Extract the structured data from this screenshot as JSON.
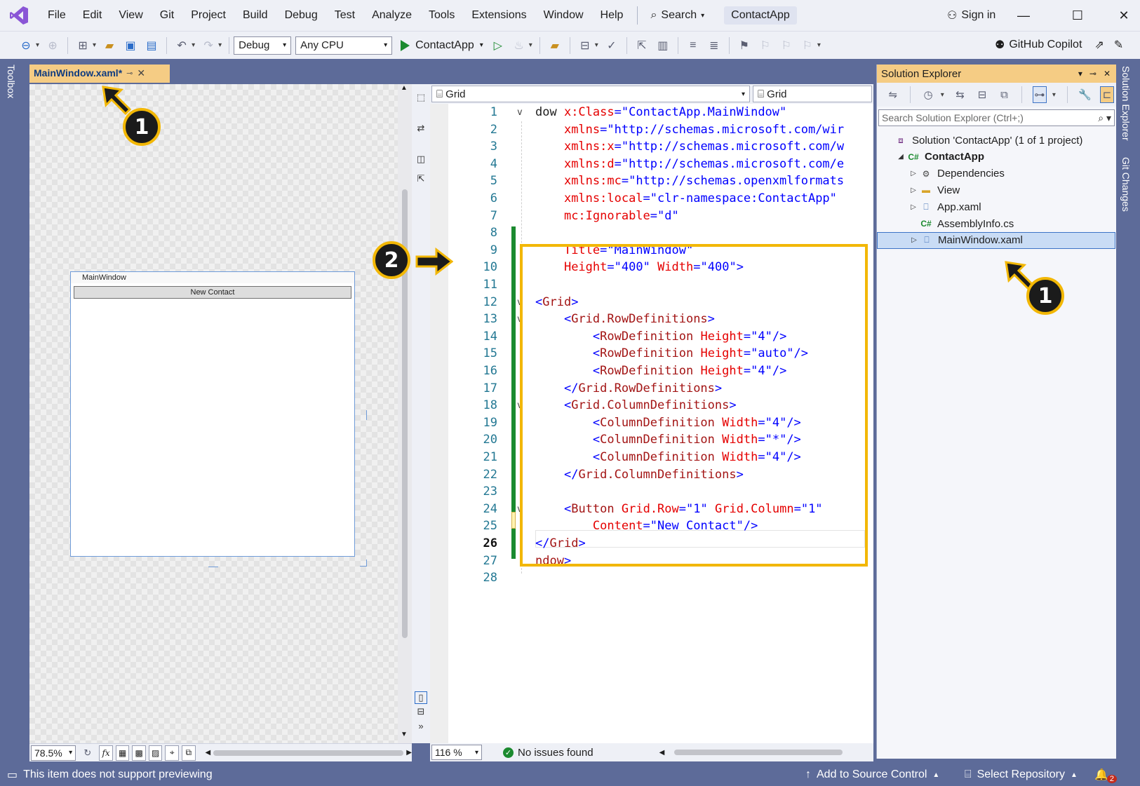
{
  "menu": {
    "items": [
      "File",
      "Edit",
      "View",
      "Git",
      "Project",
      "Build",
      "Debug",
      "Test",
      "Analyze",
      "Tools",
      "Extensions",
      "Window",
      "Help"
    ],
    "search_label": "Search",
    "app_title": "ContactApp",
    "sign_in": "Sign in"
  },
  "toolbar": {
    "config": "Debug",
    "platform": "Any CPU",
    "run_target": "ContactApp",
    "copilot": "GitHub Copilot"
  },
  "side_labels": {
    "toolbox": "Toolbox",
    "solution_explorer": "Solution Explorer",
    "git_changes": "Git Changes"
  },
  "document_tab": {
    "label": "MainWindow.xaml*"
  },
  "designer": {
    "window_title": "MainWindow",
    "button_content": "New Contact",
    "zoom": "78.5%",
    "fx_label": "fx"
  },
  "editor": {
    "nav_left": "Grid",
    "nav_right": "Grid",
    "zoom": "116 %",
    "status": "No issues found",
    "current_line": 26,
    "lines": [
      {
        "n": "1",
        "fold": "v",
        "parts": [
          [
            "tx",
            "dow "
          ],
          [
            "at",
            "x:Class"
          ],
          [
            "br",
            "="
          ],
          [
            "v",
            "\"ContactApp.MainWindow\""
          ]
        ]
      },
      {
        "n": "2",
        "parts": [
          [
            "tx",
            "    "
          ],
          [
            "at",
            "xmlns"
          ],
          [
            "br",
            "="
          ],
          [
            "v",
            "\"http://schemas.microsoft.com/wir"
          ]
        ]
      },
      {
        "n": "3",
        "parts": [
          [
            "tx",
            "    "
          ],
          [
            "at",
            "xmlns:x"
          ],
          [
            "br",
            "="
          ],
          [
            "v",
            "\"http://schemas.microsoft.com/w"
          ]
        ]
      },
      {
        "n": "4",
        "parts": [
          [
            "tx",
            "    "
          ],
          [
            "at",
            "xmlns:d"
          ],
          [
            "br",
            "="
          ],
          [
            "v",
            "\"http://schemas.microsoft.com/e"
          ]
        ]
      },
      {
        "n": "5",
        "parts": [
          [
            "tx",
            "    "
          ],
          [
            "at",
            "xmlns:mc"
          ],
          [
            "br",
            "="
          ],
          [
            "v",
            "\"http://schemas.openxmlformats"
          ]
        ]
      },
      {
        "n": "6",
        "parts": [
          [
            "tx",
            "    "
          ],
          [
            "at",
            "xmlns:local"
          ],
          [
            "br",
            "="
          ],
          [
            "v",
            "\"clr-namespace:ContactApp\""
          ]
        ]
      },
      {
        "n": "7",
        "parts": [
          [
            "tx",
            "    "
          ],
          [
            "at",
            "mc:Ignorable"
          ],
          [
            "br",
            "="
          ],
          [
            "v",
            "\"d\""
          ]
        ]
      },
      {
        "n": "8",
        "parts": []
      },
      {
        "n": "9",
        "parts": [
          [
            "tx",
            "    "
          ],
          [
            "at",
            "Title"
          ],
          [
            "br",
            "="
          ],
          [
            "v",
            "\"MainWindow\""
          ]
        ]
      },
      {
        "n": "10",
        "parts": [
          [
            "tx",
            "    "
          ],
          [
            "at",
            "Height"
          ],
          [
            "br",
            "="
          ],
          [
            "v",
            "\"400\""
          ],
          [
            "tx",
            " "
          ],
          [
            "at",
            "Width"
          ],
          [
            "br",
            "="
          ],
          [
            "v",
            "\"400\""
          ],
          [
            "br",
            ">"
          ]
        ]
      },
      {
        "n": "11",
        "parts": []
      },
      {
        "n": "12",
        "fold": "v",
        "parts": [
          [
            "br",
            "<"
          ],
          [
            "el",
            "Grid"
          ],
          [
            "br",
            ">"
          ]
        ]
      },
      {
        "n": "13",
        "fold": "v",
        "parts": [
          [
            "tx",
            "    "
          ],
          [
            "br",
            "<"
          ],
          [
            "el",
            "Grid.RowDefinitions"
          ],
          [
            "br",
            ">"
          ]
        ]
      },
      {
        "n": "14",
        "parts": [
          [
            "tx",
            "        "
          ],
          [
            "br",
            "<"
          ],
          [
            "el",
            "RowDefinition"
          ],
          [
            "tx",
            " "
          ],
          [
            "at",
            "Height"
          ],
          [
            "br",
            "="
          ],
          [
            "v",
            "\"4\""
          ],
          [
            "br",
            "/>"
          ]
        ]
      },
      {
        "n": "15",
        "parts": [
          [
            "tx",
            "        "
          ],
          [
            "br",
            "<"
          ],
          [
            "el",
            "RowDefinition"
          ],
          [
            "tx",
            " "
          ],
          [
            "at",
            "Height"
          ],
          [
            "br",
            "="
          ],
          [
            "v",
            "\"auto\""
          ],
          [
            "br",
            "/>"
          ]
        ]
      },
      {
        "n": "16",
        "parts": [
          [
            "tx",
            "        "
          ],
          [
            "br",
            "<"
          ],
          [
            "el",
            "RowDefinition"
          ],
          [
            "tx",
            " "
          ],
          [
            "at",
            "Height"
          ],
          [
            "br",
            "="
          ],
          [
            "v",
            "\"4\""
          ],
          [
            "br",
            "/>"
          ]
        ]
      },
      {
        "n": "17",
        "parts": [
          [
            "tx",
            "    "
          ],
          [
            "br",
            "</"
          ],
          [
            "el",
            "Grid.RowDefinitions"
          ],
          [
            "br",
            ">"
          ]
        ]
      },
      {
        "n": "18",
        "fold": "v",
        "parts": [
          [
            "tx",
            "    "
          ],
          [
            "br",
            "<"
          ],
          [
            "el",
            "Grid.ColumnDefinitions"
          ],
          [
            "br",
            ">"
          ]
        ]
      },
      {
        "n": "19",
        "parts": [
          [
            "tx",
            "        "
          ],
          [
            "br",
            "<"
          ],
          [
            "el",
            "ColumnDefinition"
          ],
          [
            "tx",
            " "
          ],
          [
            "at",
            "Width"
          ],
          [
            "br",
            "="
          ],
          [
            "v",
            "\"4\""
          ],
          [
            "br",
            "/>"
          ]
        ]
      },
      {
        "n": "20",
        "parts": [
          [
            "tx",
            "        "
          ],
          [
            "br",
            "<"
          ],
          [
            "el",
            "ColumnDefinition"
          ],
          [
            "tx",
            " "
          ],
          [
            "at",
            "Width"
          ],
          [
            "br",
            "="
          ],
          [
            "v",
            "\"*\""
          ],
          [
            "br",
            "/>"
          ]
        ]
      },
      {
        "n": "21",
        "parts": [
          [
            "tx",
            "        "
          ],
          [
            "br",
            "<"
          ],
          [
            "el",
            "ColumnDefinition"
          ],
          [
            "tx",
            " "
          ],
          [
            "at",
            "Width"
          ],
          [
            "br",
            "="
          ],
          [
            "v",
            "\"4\""
          ],
          [
            "br",
            "/>"
          ]
        ]
      },
      {
        "n": "22",
        "parts": [
          [
            "tx",
            "    "
          ],
          [
            "br",
            "</"
          ],
          [
            "el",
            "Grid.ColumnDefinitions"
          ],
          [
            "br",
            ">"
          ]
        ]
      },
      {
        "n": "23",
        "parts": []
      },
      {
        "n": "24",
        "fold": "v",
        "parts": [
          [
            "tx",
            "    "
          ],
          [
            "br",
            "<"
          ],
          [
            "el",
            "Button"
          ],
          [
            "tx",
            " "
          ],
          [
            "at",
            "Grid.Row"
          ],
          [
            "br",
            "="
          ],
          [
            "v",
            "\"1\""
          ],
          [
            "tx",
            " "
          ],
          [
            "at",
            "Grid.Column"
          ],
          [
            "br",
            "="
          ],
          [
            "v",
            "\"1\""
          ]
        ]
      },
      {
        "n": "25",
        "parts": [
          [
            "tx",
            "        "
          ],
          [
            "at",
            "Content"
          ],
          [
            "br",
            "="
          ],
          [
            "v",
            "\"New Contact\""
          ],
          [
            "br",
            "/>"
          ]
        ]
      },
      {
        "n": "26",
        "parts": [
          [
            "br",
            "</"
          ],
          [
            "el",
            "Grid"
          ],
          [
            "br",
            ">"
          ]
        ]
      },
      {
        "n": "27",
        "parts": [
          [
            "el",
            "ndow"
          ],
          [
            "br",
            ">"
          ]
        ]
      },
      {
        "n": "28",
        "parts": []
      }
    ]
  },
  "solution_explorer": {
    "title": "Solution Explorer",
    "search_placeholder": "Search Solution Explorer (Ctrl+;)",
    "tree": [
      {
        "label": "Solution 'ContactApp' (1 of 1 project)",
        "indent": 0,
        "twisty": "",
        "icon": "solution-icon",
        "bold": false
      },
      {
        "label": "ContactApp",
        "indent": 1,
        "twisty": "◢",
        "icon": "csharp-project-icon",
        "bold": true
      },
      {
        "label": "Dependencies",
        "indent": 2,
        "twisty": "▷",
        "icon": "dependencies-icon",
        "bold": false
      },
      {
        "label": "View",
        "indent": 2,
        "twisty": "▷",
        "icon": "folder-icon",
        "bold": false
      },
      {
        "label": "App.xaml",
        "indent": 2,
        "twisty": "▷",
        "icon": "xaml-file-icon",
        "bold": false
      },
      {
        "label": "AssemblyInfo.cs",
        "indent": 2,
        "twisty": "",
        "icon": "csharp-file-icon",
        "bold": false
      },
      {
        "label": "MainWindow.xaml",
        "indent": 2,
        "twisty": "▷",
        "icon": "xaml-file-icon",
        "bold": false,
        "selected": true
      }
    ]
  },
  "statusbar": {
    "message": "This item does not support previewing",
    "source_control": "Add to Source Control",
    "repository": "Select Repository",
    "notifications": "2"
  },
  "annotations": {
    "badge_1": "1",
    "badge_2": "2",
    "accent": "#f2b705"
  }
}
